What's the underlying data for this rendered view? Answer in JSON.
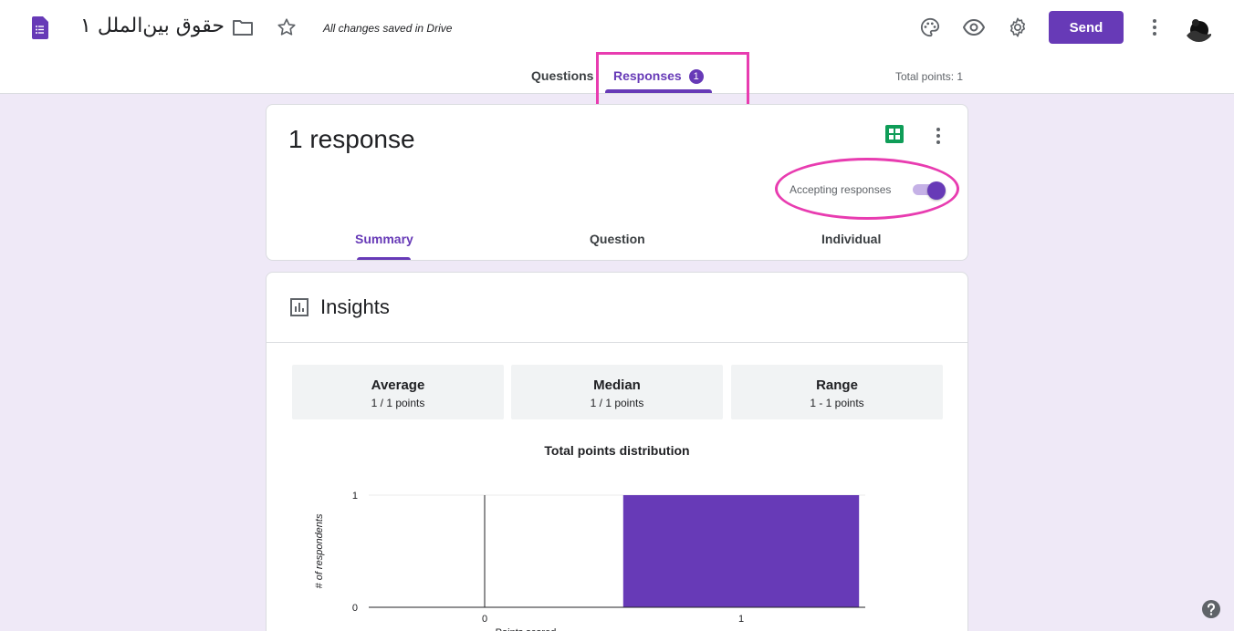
{
  "header": {
    "title": "حقوق بين‌الملل ۱",
    "saved_status": "All changes saved in Drive",
    "send_label": "Send",
    "icons": [
      "forms-logo-icon",
      "folder-icon",
      "star-icon",
      "palette-icon",
      "eye-icon",
      "gear-icon",
      "more-vert-icon"
    ]
  },
  "main_tabs": {
    "questions": "Questions",
    "responses": "Responses",
    "responses_badge": "1"
  },
  "total_points": "Total points: 1",
  "responses_card": {
    "count": "1 response",
    "accepting_label": "Accepting responses",
    "accepting_on": true,
    "tabs": {
      "summary": "Summary",
      "question": "Question",
      "individual": "Individual"
    }
  },
  "insights": {
    "title": "Insights",
    "stats": [
      {
        "label": "Average",
        "value": "1 / 1 points"
      },
      {
        "label": "Median",
        "value": "1 / 1 points"
      },
      {
        "label": "Range",
        "value": "1 - 1 points"
      }
    ]
  },
  "chart_data": {
    "type": "bar",
    "title": "Total points distribution",
    "categories": [
      "0",
      "1"
    ],
    "values": [
      0,
      1
    ],
    "xlabel": "Points scored",
    "ylabel": "# of respondents",
    "ylim": [
      0,
      1
    ],
    "yticks": [
      "0",
      "1"
    ],
    "bar_color": "#673ab7"
  },
  "colors": {
    "accent": "#673ab7",
    "annotation": "#e83cb0"
  }
}
